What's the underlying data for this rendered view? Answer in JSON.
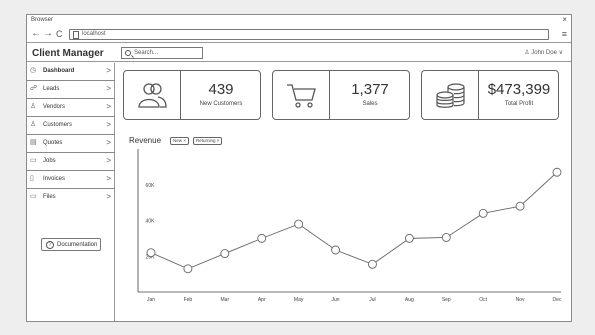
{
  "browser": {
    "title": "Browser",
    "url": "localhost",
    "nav": {
      "back": "←",
      "forward": "→",
      "reload": "C"
    },
    "close": "×",
    "menu": "≡"
  },
  "app": {
    "title": "Client Manager",
    "search_placeholder": "Search...",
    "user": "John Doe ∨"
  },
  "sidebar": {
    "items": [
      {
        "label": "Dashboard",
        "icon": "dashboard-icon",
        "glyph": "◷"
      },
      {
        "label": "Leads",
        "icon": "leads-icon",
        "glyph": "☍"
      },
      {
        "label": "Vendors",
        "icon": "vendors-icon",
        "glyph": "♙"
      },
      {
        "label": "Customers",
        "icon": "customers-icon",
        "glyph": "♙"
      },
      {
        "label": "Quotes",
        "icon": "quotes-icon",
        "glyph": "▤"
      },
      {
        "label": "Jobs",
        "icon": "jobs-icon",
        "glyph": "▭"
      },
      {
        "label": "Invoices",
        "icon": "invoices-icon",
        "glyph": "▯"
      },
      {
        "label": "Files",
        "icon": "files-icon",
        "glyph": "▭"
      }
    ],
    "chevron": ">",
    "documentation": "Documentation"
  },
  "cards": [
    {
      "value": "439",
      "label": "New Customers",
      "icon": "people-icon"
    },
    {
      "value": "1,377",
      "label": "Sales",
      "icon": "cart-icon"
    },
    {
      "value": "$473,399",
      "label": "Total Profit",
      "icon": "coins-icon"
    }
  ],
  "revenue": {
    "title": "Revenue",
    "tags": [
      "New ×",
      "Returning ×"
    ]
  },
  "chart_data": {
    "type": "line",
    "title": "Revenue",
    "categories": [
      "Jan",
      "Feb",
      "Mar",
      "Apr",
      "May",
      "Jun",
      "Jul",
      "Aug",
      "Sep",
      "Oct",
      "Nov",
      "Dec"
    ],
    "values": [
      22000,
      13000,
      21500,
      30000,
      38000,
      23500,
      15500,
      30000,
      30500,
      44000,
      48000,
      67000
    ],
    "y_ticks": [
      "20K",
      "40K",
      "60K"
    ],
    "ylim": [
      0,
      80000
    ],
    "grid": false,
    "colors": {
      "line": "#666666",
      "marker_fill": "#ffffff"
    }
  }
}
